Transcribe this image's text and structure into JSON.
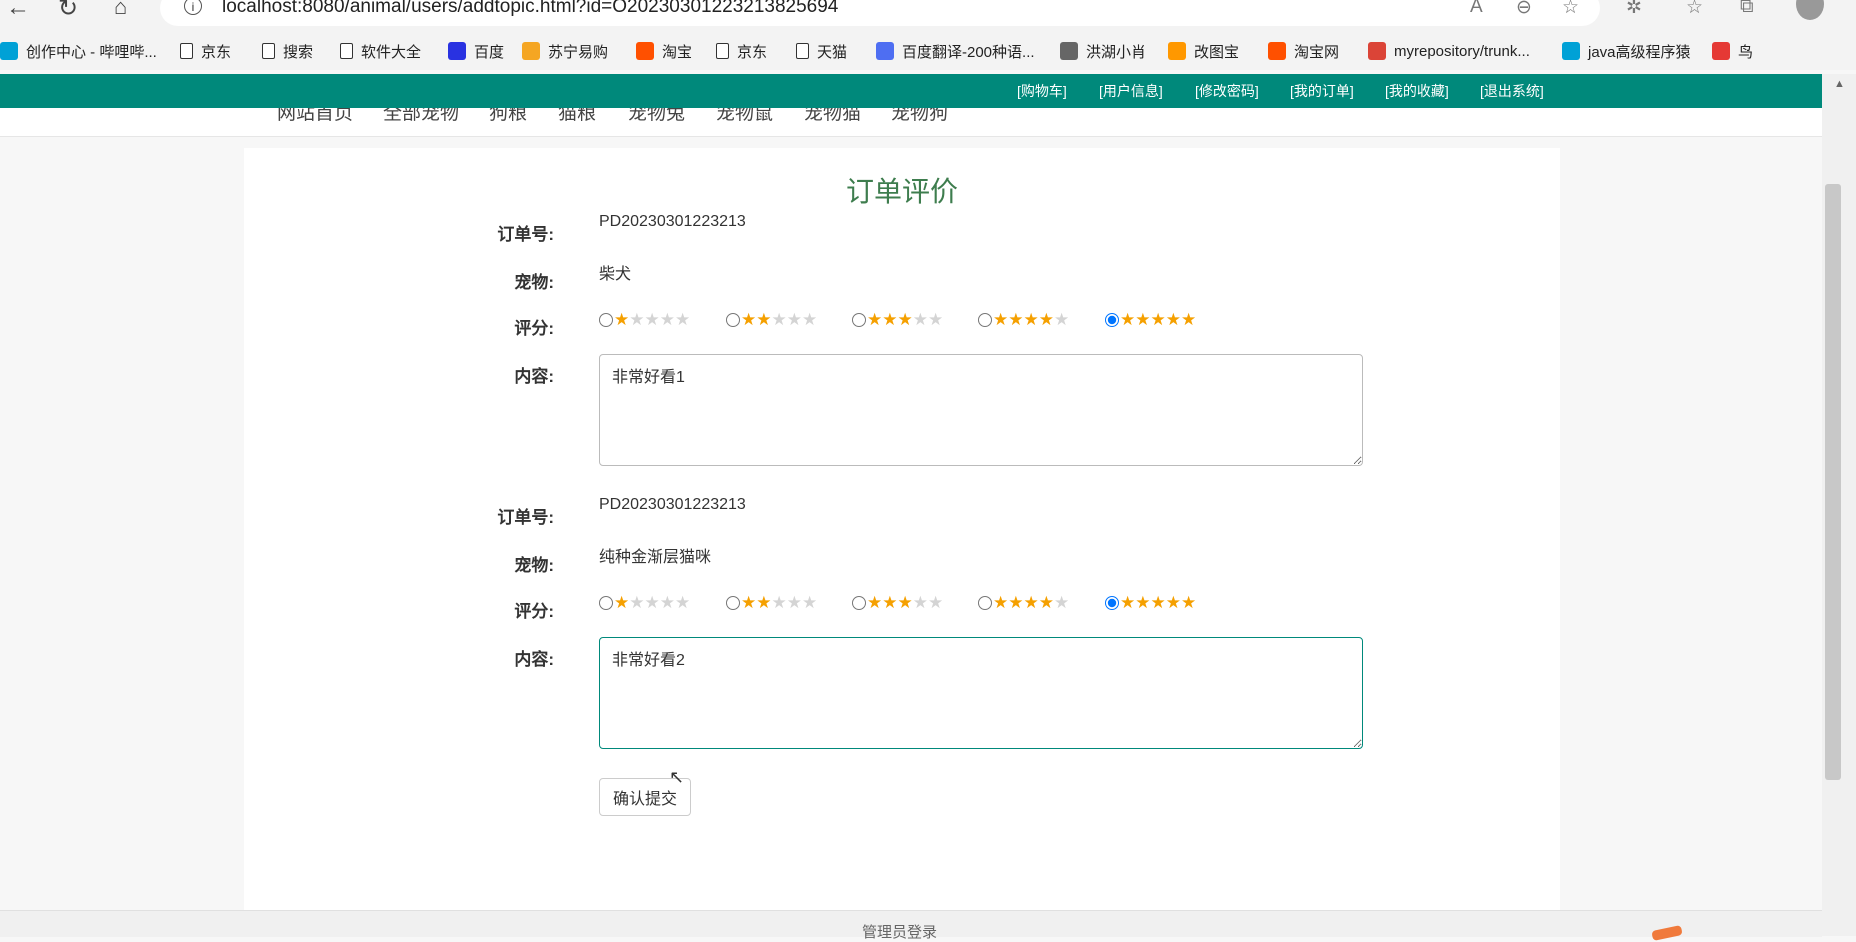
{
  "browser": {
    "url": "localhost:8080/animal/users/addtopic.html?id=O20230301223213825694",
    "bookmarks": [
      {
        "label": "创作中心 - 哔哩哔...",
        "icon": "bilibili-icon",
        "color": "#00a1d6"
      },
      {
        "label": "京东",
        "icon": "page-icon"
      },
      {
        "label": "搜索",
        "icon": "page-icon"
      },
      {
        "label": "软件大全",
        "icon": "page-icon"
      },
      {
        "label": "百度",
        "icon": "baidu-icon",
        "color": "#2932e1"
      },
      {
        "label": "苏宁易购",
        "icon": "suning-icon",
        "color": "#f5a623"
      },
      {
        "label": "淘宝",
        "icon": "taobao-icon",
        "color": "#ff5000"
      },
      {
        "label": "京东",
        "icon": "page-icon"
      },
      {
        "label": "天猫",
        "icon": "page-icon"
      },
      {
        "label": "百度翻译-200种语...",
        "icon": "translate-icon",
        "color": "#4e6ef2"
      },
      {
        "label": "洪湖小肖",
        "icon": "bird-icon",
        "color": "#666666"
      },
      {
        "label": "改图宝",
        "icon": "gaitubao-icon",
        "color": "#ff9800"
      },
      {
        "label": "淘宝网",
        "icon": "taobao-icon",
        "color": "#ff5000"
      },
      {
        "label": "myrepository/trunk...",
        "icon": "chrome-icon",
        "color": "#db4437"
      },
      {
        "label": "java高级程序猿",
        "icon": "bilibili-icon",
        "color": "#00a1d6"
      },
      {
        "label": "鸟",
        "icon": "bird-icon",
        "color": "#e53935"
      }
    ]
  },
  "topbar": {
    "links": [
      "[购物车]",
      "[用户信息]",
      "[修改密码]",
      "[我的订单]",
      "[我的收藏]",
      "[退出系统]"
    ],
    "bg_color": "#00897b"
  },
  "catnav": {
    "items": [
      "网站首页",
      "全部宠物",
      "狗粮",
      "猫粮",
      "宠物兔",
      "宠物鼠",
      "宠物猫",
      "宠物狗"
    ]
  },
  "review": {
    "title": "订单评价",
    "labels": {
      "order_no": "订单号:",
      "pet": "宠物:",
      "rating": "评分:",
      "content": "内容:"
    },
    "entries": [
      {
        "order_no": "PD20230301223213",
        "pet": "柴犬",
        "rating": 5,
        "content": "非常好看1"
      },
      {
        "order_no": "PD20230301223213",
        "pet": "纯种金渐层猫咪",
        "rating": 5,
        "content": "非常好看2"
      }
    ],
    "rating_options": [
      1,
      2,
      3,
      4,
      5
    ],
    "submit_label": "确认提交"
  },
  "footer": {
    "admin_login": "管理员登录"
  },
  "colors": {
    "accent": "#00897b",
    "title": "#3e7d4e",
    "star": "#f5a000"
  }
}
